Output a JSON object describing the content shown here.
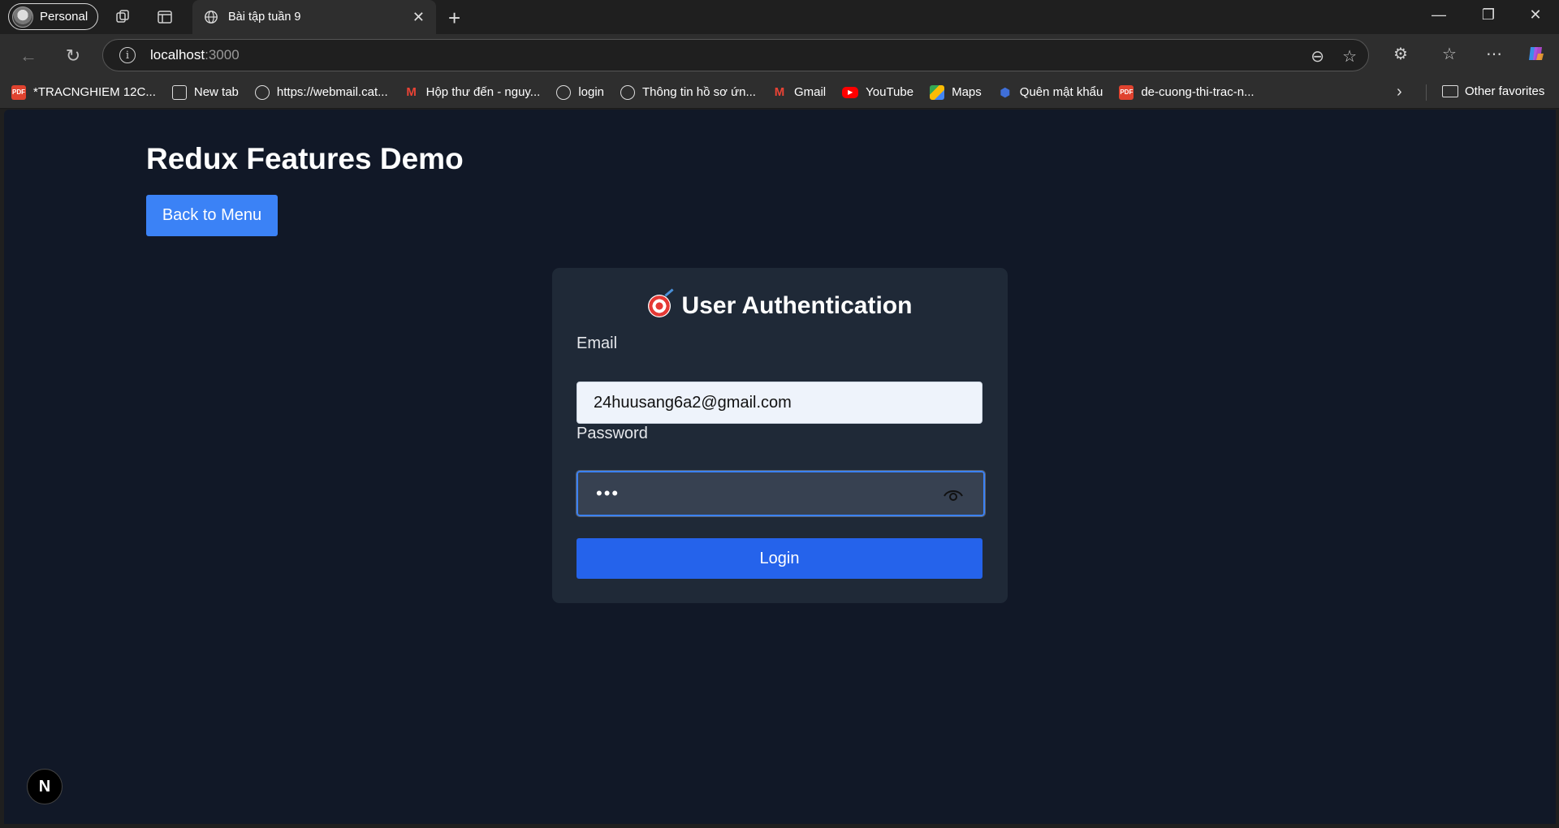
{
  "browser": {
    "profile_label": "Personal",
    "tab": {
      "title": "Bài tập tuần 9"
    },
    "url": {
      "host": "localhost",
      "port": ":3000"
    },
    "bookmarks": [
      {
        "label": "*TRACNGHIEM 12C...",
        "icon": "pdf-icon"
      },
      {
        "label": "New tab",
        "icon": "tab-icon"
      },
      {
        "label": "https://webmail.cat...",
        "icon": "globe-icon"
      },
      {
        "label": "Hộp thư đến - nguy...",
        "icon": "gmail-icon"
      },
      {
        "label": "login",
        "icon": "globe-icon"
      },
      {
        "label": "Thông tin hồ sơ ứn...",
        "icon": "globe-icon"
      },
      {
        "label": "Gmail",
        "icon": "gmail-icon"
      },
      {
        "label": "YouTube",
        "icon": "youtube-icon"
      },
      {
        "label": "Maps",
        "icon": "maps-icon"
      },
      {
        "label": "Quên mật khẩu",
        "icon": "shield-icon"
      },
      {
        "label": "de-cuong-thi-trac-n...",
        "icon": "pdf-icon"
      }
    ],
    "other_favorites": "Other favorites"
  },
  "page": {
    "title": "Redux Features Demo",
    "back_button": "Back to Menu",
    "auth": {
      "title": "User Authentication",
      "email_label": "Email",
      "email_value": "24huusang6a2@gmail.com",
      "password_label": "Password",
      "password_masked": "•••",
      "login_button": "Login"
    }
  },
  "colors": {
    "page_bg": "#111827",
    "card_bg": "#1f2937",
    "accent": "#3b82f6",
    "login_button": "#2563eb"
  }
}
